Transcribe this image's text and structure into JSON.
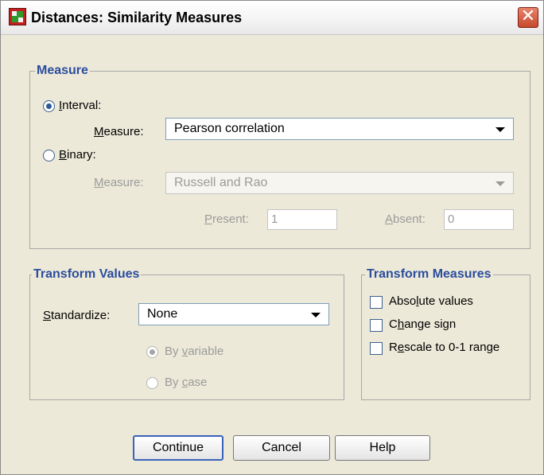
{
  "window": {
    "title": "Distances: Similarity Measures"
  },
  "measure_group": {
    "title": "Measure",
    "interval": {
      "label_u": "I",
      "label_rest": "nterval:",
      "measure_label_u": "M",
      "measure_label_rest": "easure:",
      "measure_value": "Pearson correlation",
      "selected": true
    },
    "binary": {
      "label_u": "B",
      "label_rest": "inary:",
      "measure_label_u": "M",
      "measure_label_rest": "easure:",
      "measure_value": "Russell and Rao",
      "selected": false,
      "present_label_u": "P",
      "present_label_rest": "resent:",
      "present_value": "1",
      "absent_label_u": "A",
      "absent_label_rest": "bsent:",
      "absent_value": "0"
    }
  },
  "transform_values": {
    "title": "Transform Values",
    "standardize_label_u": "S",
    "standardize_label_rest": "tandardize:",
    "standardize_value": "None",
    "by_variable_pre": "By ",
    "by_variable_u": "v",
    "by_variable_rest": "ariable",
    "by_case_pre": "By ",
    "by_case_u": "c",
    "by_case_rest": "ase"
  },
  "transform_measures": {
    "title": "Transform Measures",
    "absolute_pre": "Abso",
    "absolute_u": "l",
    "absolute_rest": "ute values",
    "change_pre": "C",
    "change_u": "h",
    "change_rest": "ange sign",
    "rescale_pre": "R",
    "rescale_u": "e",
    "rescale_rest": "scale to 0-1 range"
  },
  "buttons": {
    "continue": "Continue",
    "cancel": "Cancel",
    "help": "Help"
  }
}
